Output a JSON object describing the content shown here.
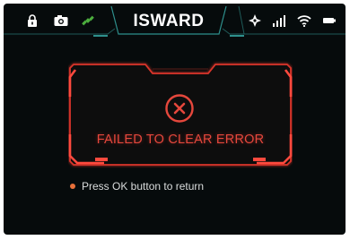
{
  "header": {
    "title": "ISWARD",
    "left_icons": [
      "lock-icon",
      "camera-icon",
      "satellite-icon"
    ],
    "right_icons": [
      "drone-icon",
      "signal-icon",
      "wifi-icon",
      "battery-icon"
    ]
  },
  "dialog": {
    "icon": "error-x-icon",
    "message": "FAILED TO CLEAR ERROR"
  },
  "hint": {
    "text": "Press OK button to return"
  },
  "colors": {
    "screen_background": "#060b0c",
    "accent_teal": "#2e8f8c",
    "error_red": "#e5473c",
    "hint_dot": "#e8703a"
  }
}
